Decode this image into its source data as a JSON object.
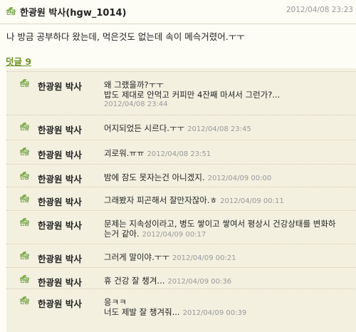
{
  "post": {
    "author": "한광원 박사(hgw_1014)",
    "date": "2012/04/08 23:23",
    "body": "나 방금 공부하다 왔는데, 먹은것도 없는데 속이 메슥거렸어.ㅜㅜ"
  },
  "comments_link": "덧글 9",
  "comments": [
    {
      "author": "한광원 박사",
      "line1": "왜 그랬을까?ㅜㅜ",
      "line2": "밥도 제대로 안먹고 커피만 4잔째 마셔서 그런가?...",
      "date": "2012/04/08 23:44"
    },
    {
      "author": "한광원 박사",
      "line1": "어지되었든 시르다.ㅜㅜ",
      "line2": "",
      "date": "2012/04/08 23:45"
    },
    {
      "author": "한광원 박사",
      "line1": "괴로워.ㅠㅠ",
      "line2": "",
      "date": "2012/04/08 23:51"
    },
    {
      "author": "한광원 박사",
      "line1": "밤에 잠도 못자는건 아니겠지.",
      "line2": "",
      "date": "2012/04/09 00:00"
    },
    {
      "author": "한광원 박사",
      "line1": "그래봤자 피곤해서 잘만자잖아.ㅎ",
      "line2": "",
      "date": "2012/04/09 00:11"
    },
    {
      "author": "한광원 박사",
      "line1": "문제는 지속성이라고, 병도 쌓이고 쌓여서 평상시 건강상태를 변화하",
      "line2": "는거 같아.",
      "date": "2012/04/09 00:17"
    },
    {
      "author": "한광원 박사",
      "line1": "그러게 말이야.ㅜㅜ",
      "line2": "",
      "date": "2012/04/09 00:21"
    },
    {
      "author": "한광원 박사",
      "line1": "휴 건강 잘 챙겨...",
      "line2": "",
      "date": "2012/04/09 00:36"
    },
    {
      "author": "한광원 박사",
      "line1": "응ㅋㅋ",
      "line2": "너도 제발 잘 챙겨줘...",
      "date": "2012/04/09 00:39"
    }
  ]
}
